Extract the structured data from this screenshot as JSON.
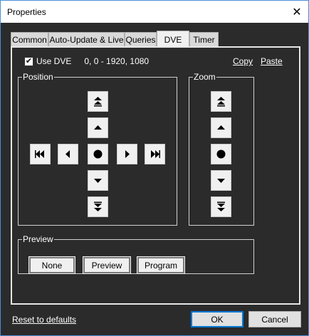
{
  "window": {
    "title": "Properties",
    "close_glyph": "✕"
  },
  "tabs": [
    {
      "label": "Common",
      "active": false
    },
    {
      "label": "Auto-Update & Live",
      "active": false
    },
    {
      "label": "Queries",
      "active": false
    },
    {
      "label": "DVE",
      "active": true
    },
    {
      "label": "Timer",
      "active": false
    }
  ],
  "dve": {
    "use_dve_label": "Use DVE",
    "use_dve_checked": true,
    "check_glyph": "✔",
    "coords": "0, 0 - 1920, 1080",
    "copy_label": "Copy",
    "paste_label": "Paste"
  },
  "position": {
    "legend": "Position",
    "buttons": [
      "up-fast",
      "up",
      "left-fast",
      "left",
      "center",
      "right",
      "right-fast",
      "down",
      "down-fast"
    ]
  },
  "zoom": {
    "legend": "Zoom",
    "buttons": [
      "zoom-in-fast",
      "zoom-in",
      "zoom-reset",
      "zoom-out",
      "zoom-out-fast"
    ]
  },
  "preview": {
    "legend": "Preview",
    "none_label": "None",
    "preview_label": "Preview",
    "program_label": "Program"
  },
  "footer": {
    "reset_label": "Reset to defaults",
    "ok_label": "OK",
    "cancel_label": "Cancel"
  },
  "colors": {
    "background": "#2b2b2b",
    "accent": "#0078d7",
    "button_face": "#f0f0f0",
    "text": "#ffffff"
  }
}
